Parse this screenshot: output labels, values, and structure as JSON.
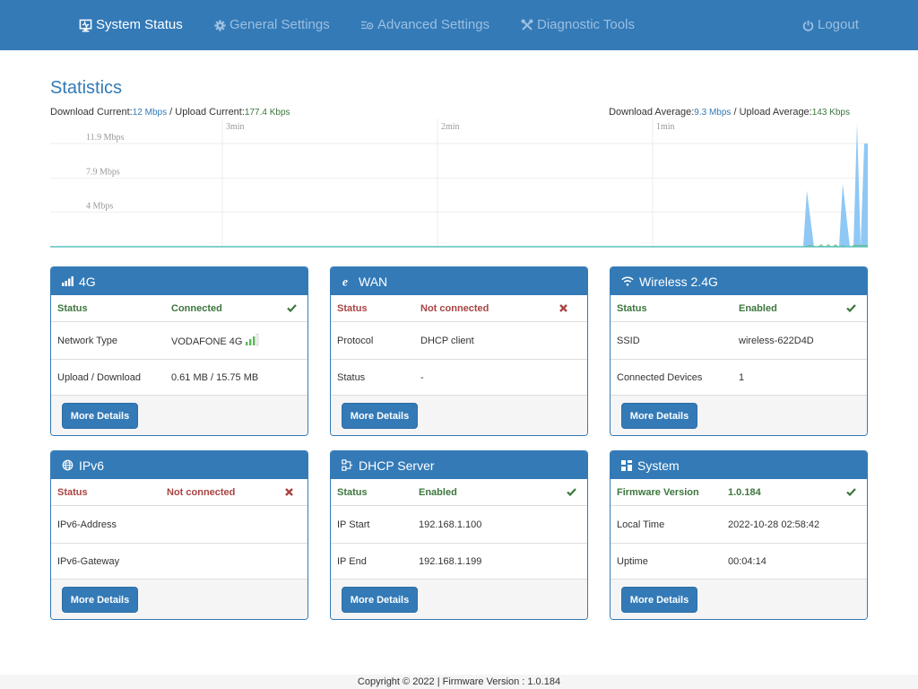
{
  "nav": {
    "items": [
      {
        "label": "System Status",
        "icon": "monitor-icon",
        "active": true
      },
      {
        "label": "General Settings",
        "icon": "gear-icon",
        "active": false
      },
      {
        "label": "Advanced Settings",
        "icon": "sliders-icon",
        "active": false
      },
      {
        "label": "Diagnostic Tools",
        "icon": "tools-icon",
        "active": false
      }
    ],
    "logout": {
      "label": "Logout",
      "icon": "power-icon"
    }
  },
  "statistics": {
    "title": "Statistics",
    "download_current_label": "Download Current:",
    "download_current": "12 Mbps",
    "upload_current_label": "Upload Current:",
    "upload_current": "177.4 Kbps",
    "download_average_label": "Download Average:",
    "download_average": "9.3 Mbps",
    "upload_average_label": "Upload Average:",
    "upload_average": "143 Kbps",
    "separator": "/"
  },
  "chart_data": {
    "type": "area",
    "title": "",
    "xlabel": "",
    "ylabel": "",
    "y_unit": "Mbps",
    "y_ticks": [
      {
        "value": 4,
        "label": "4 Mbps"
      },
      {
        "value": 7.9,
        "label": "7.9 Mbps"
      },
      {
        "value": 11.9,
        "label": "11.9 Mbps"
      }
    ],
    "x_ticks": [
      {
        "value": -180,
        "label": "3min"
      },
      {
        "value": -120,
        "label": "2min"
      },
      {
        "value": -60,
        "label": "1min"
      }
    ],
    "x_unit": "seconds ago",
    "xlim": [
      -228,
      0
    ],
    "ylim": [
      0,
      14.8
    ],
    "grid": true,
    "series": [
      {
        "name": "Download",
        "color": "#8fc8f5",
        "x": [
          -228,
          -18,
          -17,
          -15,
          -12,
          -10,
          -8,
          -7,
          -5,
          -4,
          -3,
          -2,
          -1,
          0
        ],
        "values": [
          0,
          0,
          6.5,
          0,
          0,
          0,
          0,
          7.3,
          0,
          0,
          14.3,
          0,
          11.9,
          11.9
        ]
      },
      {
        "name": "Upload",
        "color": "#5cb85c",
        "x": [
          -228,
          -18,
          -16,
          -14,
          -13,
          -12,
          -11,
          -10,
          -9,
          -8,
          -7,
          -6,
          -5,
          -4,
          -3,
          -2,
          -1,
          0
        ],
        "values": [
          0,
          0,
          0.2,
          0,
          0.3,
          0,
          0.3,
          0,
          0.3,
          0,
          0.2,
          0,
          0,
          0.2,
          0.2,
          0.2,
          0.2,
          0.2
        ]
      }
    ]
  },
  "panels": [
    {
      "title": "4G",
      "icon": "signal-bars-icon",
      "status": {
        "label": "Status",
        "value": "Connected",
        "ok": true
      },
      "rows": [
        {
          "label": "Network Type",
          "value": "VODAFONE 4G"
        },
        {
          "label": "Upload / Download",
          "value": "0.61 MB / 15.75 MB"
        }
      ],
      "button": "More Details"
    },
    {
      "title": "WAN",
      "icon": "internet-e-icon",
      "status": {
        "label": "Status",
        "value": "Not connected",
        "ok": false
      },
      "rows": [
        {
          "label": "Protocol",
          "value": "DHCP client"
        },
        {
          "label": "Status",
          "value": "-"
        }
      ],
      "button": "More Details"
    },
    {
      "title": "Wireless 2.4G",
      "icon": "wifi-icon",
      "status": {
        "label": "Status",
        "value": "Enabled",
        "ok": true
      },
      "rows": [
        {
          "label": "SSID",
          "value": "wireless-622D4D"
        },
        {
          "label": "Connected Devices",
          "value": "1"
        }
      ],
      "button": "More Details"
    },
    {
      "title": "IPv6",
      "icon": "globe-icon",
      "status": {
        "label": "Status",
        "value": "Not connected",
        "ok": false
      },
      "rows": [
        {
          "label": "IPv6-Address",
          "value": ""
        },
        {
          "label": "IPv6-Gateway",
          "value": ""
        }
      ],
      "button": "More Details"
    },
    {
      "title": "DHCP Server",
      "icon": "dhcp-network-icon",
      "status": {
        "label": "Status",
        "value": "Enabled",
        "ok": true
      },
      "rows": [
        {
          "label": "IP Start",
          "value": "192.168.1.100"
        },
        {
          "label": "IP End",
          "value": "192.168.1.199"
        }
      ],
      "button": "More Details"
    },
    {
      "title": "System",
      "icon": "grid-icon",
      "status": {
        "label": "Firmware Version",
        "value": "1.0.184",
        "ok": true
      },
      "rows": [
        {
          "label": "Local Time",
          "value": "2022-10-28 02:58:42"
        },
        {
          "label": "Uptime",
          "value": "00:04:14"
        }
      ],
      "button": "More Details"
    }
  ],
  "footer": {
    "text": "Copyright © 2022  |  Firmware Version : 1.0.184"
  },
  "colors": {
    "brand": "#337ab7",
    "ok": "#3c763d",
    "error": "#a94442",
    "download": "#337ab7",
    "upload": "#3c763d"
  }
}
